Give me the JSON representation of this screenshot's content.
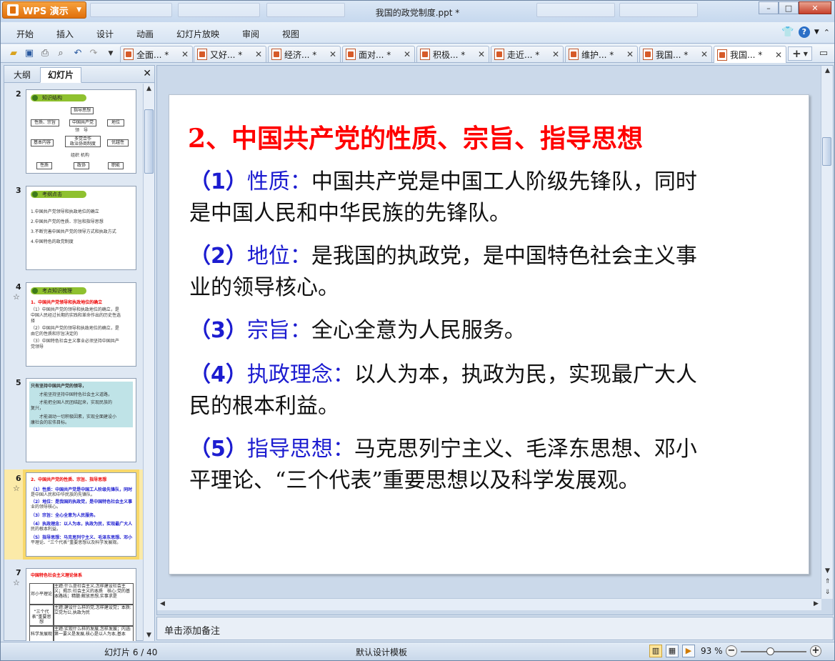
{
  "app": {
    "name": "WPS 演示",
    "doc_title": "我国的政党制度.ppt *"
  },
  "window_controls": {
    "minimize": "–",
    "maximize": "□",
    "close": "✕"
  },
  "menu": [
    "开始",
    "插入",
    "设计",
    "动画",
    "幻灯片放映",
    "审阅",
    "视图"
  ],
  "tabs": [
    {
      "label": "全面... *"
    },
    {
      "label": "又好... *"
    },
    {
      "label": "经济... *"
    },
    {
      "label": "面对... *"
    },
    {
      "label": "积极... *"
    },
    {
      "label": "走近... *"
    },
    {
      "label": "维护... *"
    },
    {
      "label": "我国... *"
    },
    {
      "label": "我国... *",
      "active": true
    }
  ],
  "tab_close": "✕",
  "new_tab": "+",
  "left_pane": {
    "tab_outline": "大纲",
    "tab_slides": "幻灯片",
    "close": "✕"
  },
  "thumbnails": {
    "s2": {
      "num": "2",
      "pill": "知识结构",
      "nodes": [
        "指导思想",
        "性质、宗旨",
        "中国共产党",
        "地位",
        "领　导",
        "基本内容",
        "多党合作",
        "政治协商制度",
        "优越性",
        "组织 机构",
        "性质",
        "政协",
        "职能"
      ]
    },
    "s3": {
      "num": "3",
      "pill": "考纲点击",
      "lines": [
        "1.中国共产党领导和执政地位的确立",
        "2.中国共产党的性质、宗旨和指导思想",
        "3.不断完善中国共产党的领导方式和执政方式",
        "4.中国特色的政党制度"
      ]
    },
    "s4": {
      "num": "4",
      "star": "☆",
      "pill": "考点知识梳理",
      "lines": [
        "1、中国共产党领导和执政地位的确立",
        "（1）中国共产党的领导和执政地位的确立，是",
        "中国人民经过长期的实践和革命作出的历史性选",
        "择",
        "（2）中国共产党的领导和执政地位的确立，是",
        "由它的性质和宗旨决定的",
        "（3）中国特色社会主义事业必须坚持中国共产",
        "党领导"
      ]
    },
    "s5": {
      "num": "5",
      "lines": [
        "只有坚持中国共产党的领导，",
        "才能坚持坚持中国特色社会主义道路，",
        "才能把全国人民团结起来，实现民族的",
        "复兴，",
        "才能调动一切积极因素，实现全面建设小",
        "康社会的宏伟目标。"
      ]
    },
    "s6": {
      "num": "6",
      "star": "☆",
      "lines": [
        "2、中国共产党的性质、宗旨、指导思想",
        "（1）性质：中国共产党是中国工人阶级先锋队，同时",
        "是中国人民和中华民族的先锋队。",
        "（2）地位：是我国的执政党，是中国特色社会主义事",
        "业的领导核心。",
        "（3）宗旨：全心全意为人民服务。",
        "（4）执政理念：以人为本，执政为民，实现最广大人",
        "民的根本利益。",
        "（5）指导思想：马克思列宁主义、毛泽东思想、邓小",
        "平理论、“三个代表”重要思想以及科学发展观。"
      ]
    },
    "s7": {
      "num": "7",
      "star": "☆",
      "title": "中国特色社会主义理论体系",
      "rows": [
        {
          "k": "邓小平理论",
          "v": "主题:什么是社会主义,怎样建设社会主义；揭示:社会主义的本质　核心:党的基本路线；精髓:解放思想,实事求是"
        },
        {
          "k": "“三个代表”重要思想",
          "v": "主题:建设什么样的党,怎样建设党；本质:立党为公,执政为民"
        },
        {
          "k": "科学发展观",
          "v": "主题:实现什么样的发展,怎样发展；内涵:第一要义是发展,核心是以人为本,基本"
        }
      ]
    }
  },
  "slide": {
    "title": "2、中国共产党的性质、宗旨、指导思想",
    "items": [
      {
        "num": "（1）",
        "label": "性质：",
        "line1": "中国共产党是中国工人阶级先锋队，同时",
        "line2": "是中国人民和中华民族的先锋队。"
      },
      {
        "num": "（2）",
        "label": "地位：",
        "line1": "是我国的执政党，是中国特色社会主义事",
        "line2": "业的领导核心。"
      },
      {
        "num": "（3）",
        "label": "宗旨：",
        "line1": "全心全意为人民服务。",
        "line2": ""
      },
      {
        "num": "（4）",
        "label": "执政理念：",
        "line1": "以人为本，执政为民，实现最广大人",
        "line2": "民的根本利益。"
      },
      {
        "num": "（5）",
        "label": "指导思想：",
        "line1": "马克思列宁主义、毛泽东思想、邓小",
        "line2": "平理论、“三个代表”重要思想以及科学发展观。"
      }
    ]
  },
  "notes_placeholder": "单击添加备注",
  "status": {
    "slide_count": "幻灯片 6 / 40",
    "template": "默认设计模板",
    "zoom": "93 %",
    "zoom_level_percent": 93
  },
  "colors": {
    "title_red": "#ff0000",
    "label_blue": "#1c1cd0",
    "wps_orange": "#e0700c"
  }
}
